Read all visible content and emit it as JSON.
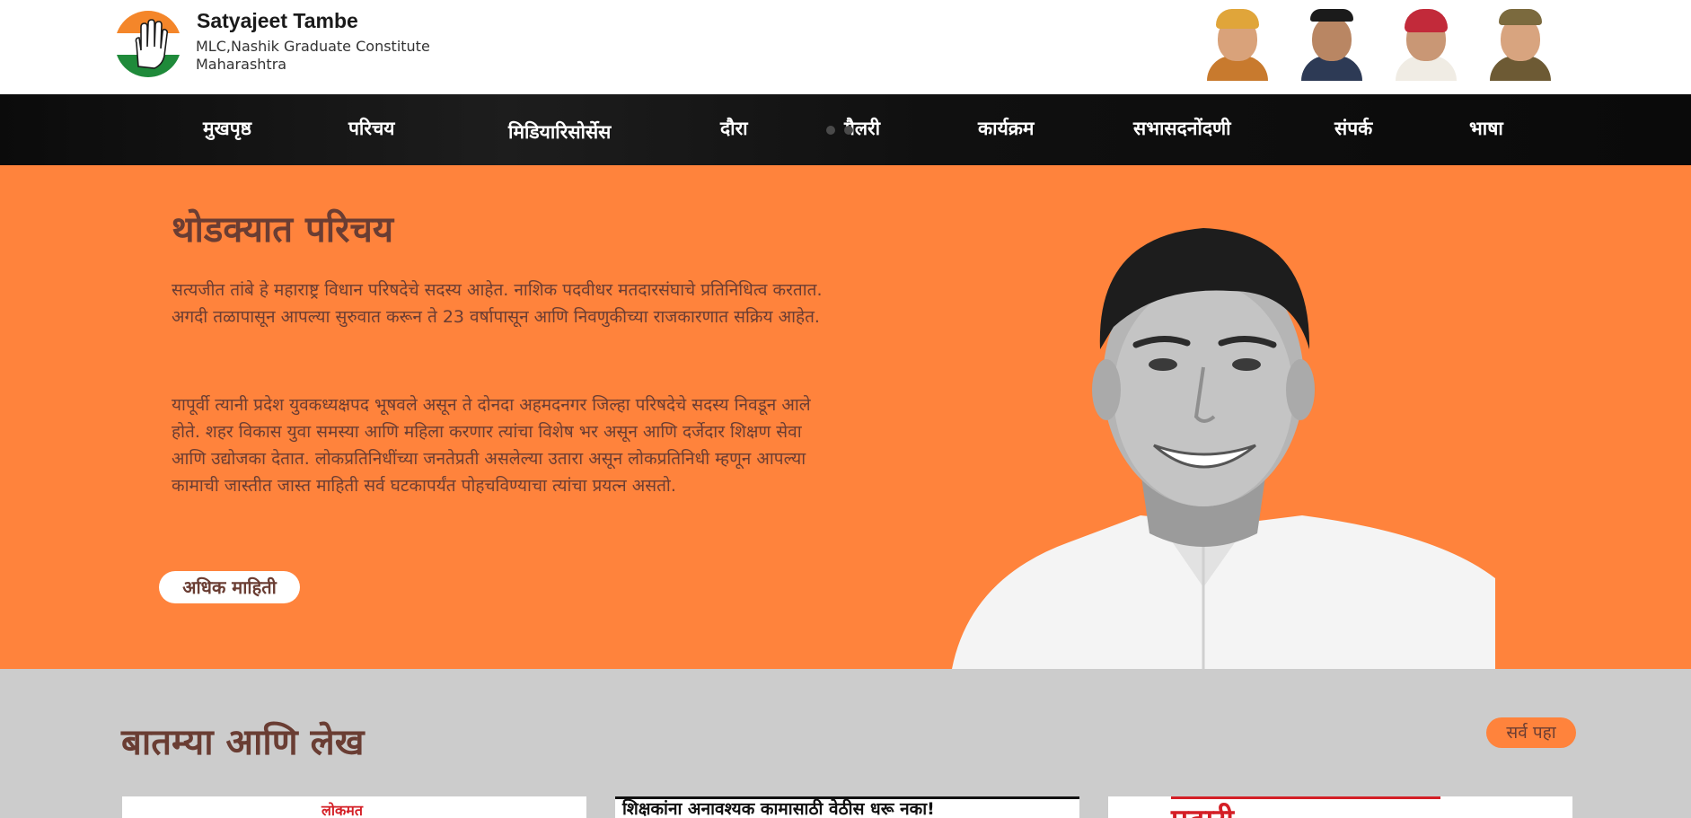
{
  "header": {
    "name": "Satyajeet Tambe",
    "subtitle": "MLC,Nashik Graduate Constitute Maharashtra",
    "logo_icon": "party-hand-logo-icon",
    "leader_portraits": [
      "leader-portrait-1",
      "leader-portrait-2",
      "leader-portrait-3",
      "leader-portrait-4"
    ]
  },
  "nav": {
    "items": [
      {
        "label": "मुखपृष्ठ"
      },
      {
        "label": "परिचय"
      },
      {
        "label": "मिडियारिसोर्सेस"
      },
      {
        "label": "दौरा"
      },
      {
        "label": "गैलरी"
      },
      {
        "label": "कार्यक्रम"
      },
      {
        "label": "सभासदनोंदणी"
      },
      {
        "label": "संपर्क"
      },
      {
        "label": "भाषा"
      }
    ]
  },
  "intro": {
    "title": "थोडक्यात परिचय",
    "paragraph1": "सत्यजीत तांबे हे महाराष्ट्र विधान परिषदेचे सदस्य आहेत. नाशिक पदवीधर मतदारसंघाचे प्रतिनिधित्व करतात. अगदी तळापासून आपल्या सुरुवात करून ते 23 वर्षापासून आणि निवणुकीच्या राजकारणात सक्रिय आहेत.",
    "paragraph2": "यापूर्वी त्यानी प्रदेश युवकध्यक्षपद भूषवले असून ते दोनदा अहमदनगर जिल्हा परिषदेचे सदस्य निवडून आले होते. शहर विकास युवा समस्या आणि महिला करणार त्यांचा विशेष भर असून आणि दर्जेदार शिक्षण सेवा आणि उद्योजका देतात. लोकप्रतिनिधींच्या जनतेप्रती असलेल्या उतारा असून लोकप्रतिनिधी म्हणून आपल्या कामाची जास्तीत जास्त माहिती सर्व घटकापर्यंत पोहचविण्याचा त्यांचा प्रयत्न असतो.",
    "more_button": "अधिक माहिती"
  },
  "news": {
    "title": "बातम्या आणि लेख",
    "view_all": "सर्व पहा",
    "cards": [
      {
        "masthead": "लोकमत"
      },
      {
        "headline": "शिक्षकांना अनावश्यक कामासाठी वेठीस धरू नका!"
      },
      {
        "masthead": "पुढारी"
      }
    ]
  },
  "colors": {
    "accent_orange": "#ff833c",
    "text_brown": "#6a3d33",
    "nav_bg": "#0b0b0b",
    "news_bg": "#cccccc"
  }
}
